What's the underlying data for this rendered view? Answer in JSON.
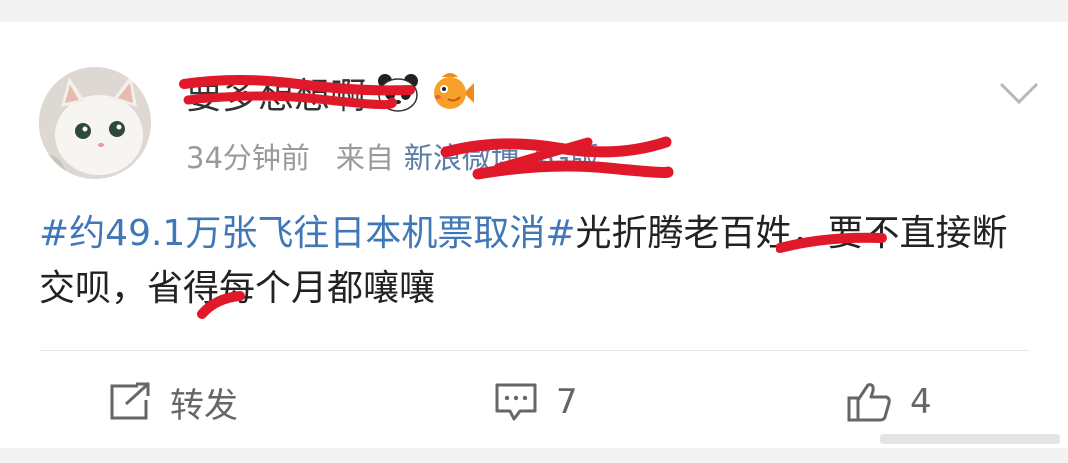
{
  "post": {
    "username": "要多想想啊",
    "time": "34分钟前",
    "source_prefix": "来自",
    "source": "新浪微博 4G版",
    "topic": "#约49.1万张飞往日本机票取消#",
    "body": "光折腾老百姓，要不直接断交呗，省得每个月都嚷嚷"
  },
  "actions": {
    "repost_label": "转发",
    "comment_count": "7",
    "like_count": "4"
  },
  "icons": [
    "panda-emoji-icon",
    "fish-emoji-icon",
    "chevron-down-icon",
    "repost-icon",
    "comment-icon",
    "like-icon"
  ],
  "colors": {
    "topic": "#3f77b8",
    "redaction": "#e0192a",
    "meta": "#9a9a9a"
  }
}
